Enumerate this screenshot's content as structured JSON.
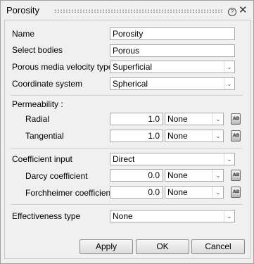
{
  "dialog": {
    "title": "Porosity",
    "help_glyph": "?",
    "close_glyph": "✕"
  },
  "form": {
    "name_label": "Name",
    "name_value": "Porosity",
    "bodies_label": "Select bodies",
    "bodies_value": "Porous",
    "velocity_label": "Porous media velocity type",
    "velocity_value": "Superficial",
    "coord_label": "Coordinate system",
    "coord_value": "Spherical",
    "permeability_label": "Permeability :",
    "radial_label": "Radial",
    "radial_value": "1.0",
    "radial_unit": "None",
    "tangential_label": "Tangential",
    "tangential_value": "1.0",
    "tangential_unit": "None",
    "coef_input_label": "Coefficient input",
    "coef_input_value": "Direct",
    "darcy_label": "Darcy coefficient",
    "darcy_value": "0.0",
    "darcy_unit": "None",
    "forch_label": "Forchheimer coefficient",
    "forch_value": "0.0",
    "forch_unit": "None",
    "effectiveness_label": "Effectiveness type",
    "effectiveness_value": "None",
    "unit_button_glyph": "AB"
  },
  "buttons": {
    "apply": "Apply",
    "ok": "OK",
    "cancel": "Cancel"
  },
  "icons": {
    "dropdown_arrow": "⌄"
  }
}
